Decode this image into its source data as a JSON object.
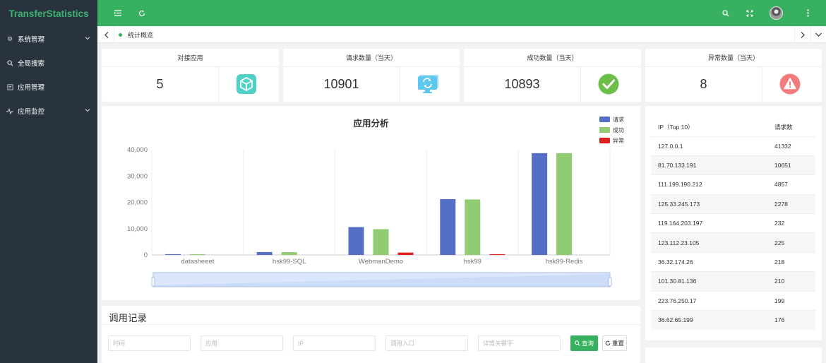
{
  "app": {
    "title": "TransferStatistics"
  },
  "sidebar": {
    "items": [
      {
        "label": "系统管理",
        "icon": "gear-icon",
        "expandable": true
      },
      {
        "label": "全局搜索",
        "icon": "search-icon",
        "expandable": false
      },
      {
        "label": "应用管理",
        "icon": "app-manage-icon",
        "expandable": false
      },
      {
        "label": "应用监控",
        "icon": "pulse-icon",
        "expandable": true
      }
    ]
  },
  "header": {
    "icons": [
      "menu-icon",
      "refresh-icon",
      "search-icon",
      "fullscreen-icon",
      "avatar",
      "more-icon"
    ]
  },
  "tabs": {
    "active": "统计概览"
  },
  "stats": [
    {
      "title": "对接应用",
      "value": "5",
      "icon": "cube-icon",
      "color": "#4fd1c5"
    },
    {
      "title": "请求数量（当天）",
      "value": "10901",
      "icon": "monitor-refresh-icon",
      "color": "#5bc8ef"
    },
    {
      "title": "成功数量（当天）",
      "value": "10893",
      "icon": "check-circle-icon",
      "color": "#6cc04a"
    },
    {
      "title": "异常数量（当天）",
      "value": "8",
      "icon": "warning-icon",
      "color": "#f47b7b"
    }
  ],
  "chart_data": {
    "type": "bar",
    "title": "应用分析",
    "categories": [
      "datasheeet",
      "hsk99-SQL",
      "WebmanDemo",
      "hsk99",
      "hsk99-Redis"
    ],
    "series": [
      {
        "name": "请求",
        "color": "#5470c6",
        "values": [
          300,
          1100,
          10600,
          21200,
          38700
        ]
      },
      {
        "name": "成功",
        "color": "#91cc75",
        "values": [
          280,
          1050,
          9800,
          21100,
          38700
        ]
      },
      {
        "name": "异常",
        "color": "#dd1f1f",
        "values": [
          0,
          0,
          900,
          200,
          0
        ]
      }
    ],
    "yticks": [
      "0",
      "10,000",
      "20,000",
      "30,000",
      "40,000"
    ],
    "ylim": [
      0,
      40000
    ],
    "legend": "top-right",
    "grid": true,
    "datazoom": true
  },
  "ip_table": {
    "headers": [
      "IP（Top 10）",
      "请求数"
    ],
    "rows": [
      [
        "127.0.0.1",
        "41332"
      ],
      [
        "81.70.133.191",
        "10651"
      ],
      [
        "111.199.190.212",
        "4857"
      ],
      [
        "125.33.245.173",
        "2278"
      ],
      [
        "119.164.203.197",
        "232"
      ],
      [
        "123.112.23.105",
        "225"
      ],
      [
        "36.32.174.26",
        "218"
      ],
      [
        "101.30.81.136",
        "210"
      ],
      [
        "223.76.250.17",
        "199"
      ],
      [
        "36.62.65.199",
        "176"
      ]
    ]
  },
  "records": {
    "title": "调用记录",
    "fields": [
      {
        "name": "time-input",
        "placeholder": "时间"
      },
      {
        "name": "app-input",
        "placeholder": "应用"
      },
      {
        "name": "ip-input",
        "placeholder": "IP"
      },
      {
        "name": "entry-input",
        "placeholder": "调用入口"
      },
      {
        "name": "keyword-input",
        "placeholder": "详情关键字"
      }
    ],
    "search_label": "查询",
    "reset_label": "重置"
  }
}
